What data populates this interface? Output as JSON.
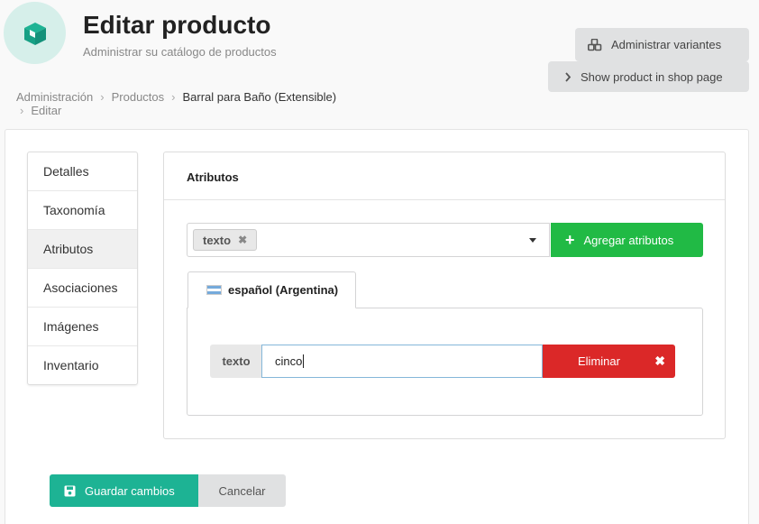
{
  "header": {
    "title": "Editar producto",
    "subtitle": "Administrar su catálogo de productos",
    "icon": "cube-icon"
  },
  "actions": {
    "manage_variants": "Administrar variantes",
    "show_in_shop": "Show product in shop page"
  },
  "breadcrumb": [
    "Administración",
    "Productos",
    "Barral para Baño (Extensible)",
    "Editar"
  ],
  "sidebar": {
    "items": [
      {
        "label": "Detalles"
      },
      {
        "label": "Taxonomía"
      },
      {
        "label": "Atributos",
        "active": true
      },
      {
        "label": "Asociaciones"
      },
      {
        "label": "Imágenes"
      },
      {
        "label": "Inventario"
      }
    ]
  },
  "attributes": {
    "title": "Atributos",
    "selected_chip": "texto",
    "add_button": "Agregar atributos",
    "locale_tab": "español (Argentina)",
    "field_label": "texto",
    "field_value": "cinco",
    "delete_button": "Eliminar"
  },
  "form": {
    "save": "Guardar cambios",
    "cancel": "Cancelar"
  },
  "colors": {
    "accent_teal": "#1db394",
    "green": "#21ba45",
    "red": "#db2828",
    "gray_button": "#e0e1e2"
  }
}
